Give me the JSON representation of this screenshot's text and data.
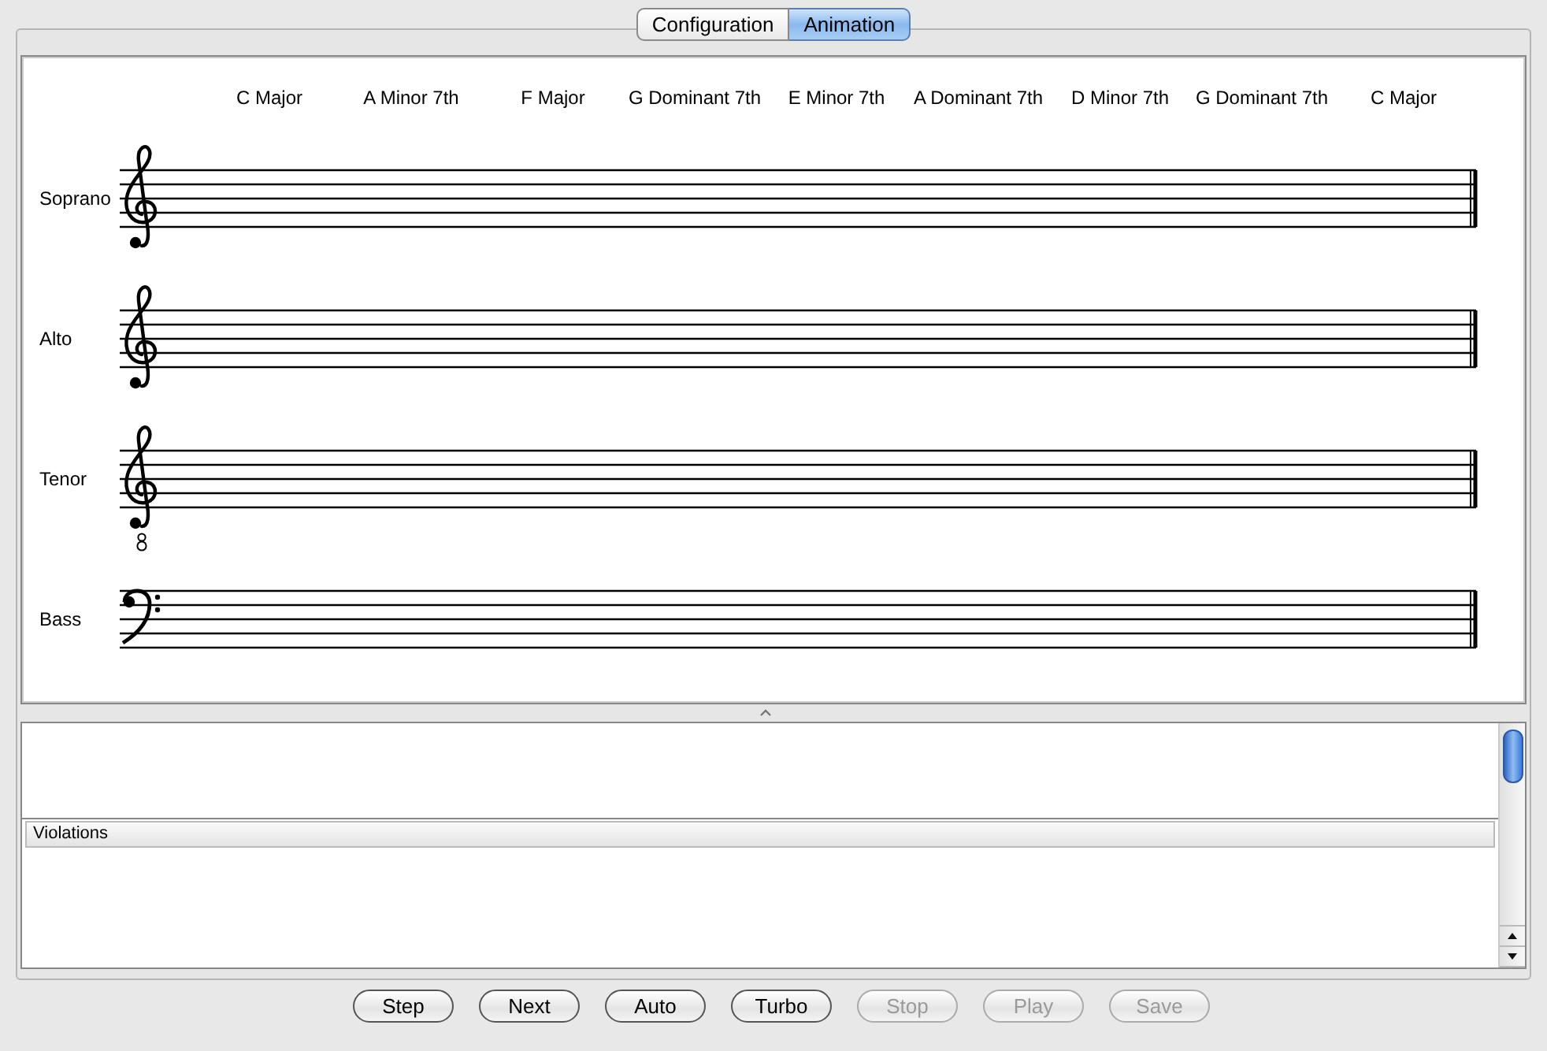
{
  "tabs": [
    {
      "label": "Configuration",
      "selected": false
    },
    {
      "label": "Animation",
      "selected": true
    }
  ],
  "score": {
    "chords": [
      "C Major",
      "A Minor 7th",
      "F Major",
      "G Dominant 7th",
      "E Minor 7th",
      "A Dominant 7th",
      "D Minor 7th",
      "G Dominant 7th",
      "C Major"
    ],
    "staves": [
      {
        "name": "Soprano",
        "kind": "treble"
      },
      {
        "name": "Alto",
        "kind": "treble"
      },
      {
        "name": "Tenor",
        "kind": "treble8"
      },
      {
        "name": "Bass",
        "kind": "bass"
      }
    ]
  },
  "violations": {
    "header": "Violations"
  },
  "buttons": [
    {
      "label": "Step",
      "disabled": false
    },
    {
      "label": "Next",
      "disabled": false
    },
    {
      "label": "Auto",
      "disabled": false
    },
    {
      "label": "Turbo",
      "disabled": false
    },
    {
      "label": "Stop",
      "disabled": true
    },
    {
      "label": "Play",
      "disabled": true
    },
    {
      "label": "Save",
      "disabled": true
    }
  ]
}
